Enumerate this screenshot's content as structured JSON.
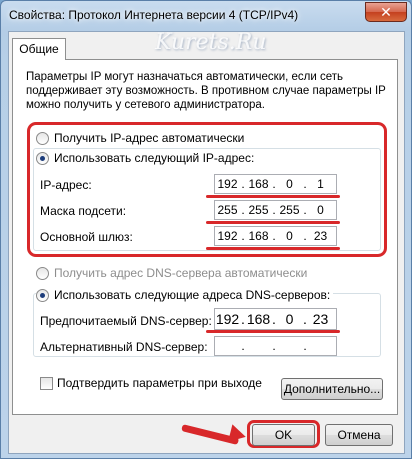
{
  "window": {
    "title": "Свойства: Протокол Интернета версии 4 (TCP/IPv4)",
    "close_glyph": "✕"
  },
  "watermark": "Kurets.Ru",
  "tabs": [
    {
      "label": "Общие"
    }
  ],
  "description": "Параметры IP могут назначаться автоматически, если сеть поддерживает эту возможность. В противном случае параметры IP можно получить у сетевого администратора.",
  "ip": {
    "auto_label": "Получить IP-адрес автоматически",
    "manual_label": "Использовать следующий IP-адрес:",
    "selected": "manual",
    "address": {
      "label": "IP-адрес:",
      "octets": [
        "192",
        "168",
        "0",
        "1"
      ]
    },
    "mask": {
      "label": "Маска подсети:",
      "octets": [
        "255",
        "255",
        "255",
        "0"
      ]
    },
    "gateway": {
      "label": "Основной шлюз:",
      "octets": [
        "192",
        "168",
        "0",
        "23"
      ]
    }
  },
  "dns": {
    "auto_label": "Получить адрес DNS-сервера автоматически",
    "manual_label": "Использовать следующие адреса DNS-серверов:",
    "selected": "manual",
    "preferred": {
      "label": "Предпочитаемый DNS-сервер:",
      "octets": [
        "192",
        "168",
        "0",
        "23"
      ]
    },
    "alternate": {
      "label": "Альтернативный DNS-сервер:",
      "octets": [
        "",
        "",
        "",
        ""
      ]
    }
  },
  "validate": {
    "label": "Подтвердить параметры при выходе",
    "checked": false
  },
  "buttons": {
    "advanced": "Дополнительно...",
    "ok": "OK",
    "cancel": "Отмена"
  },
  "colors": {
    "highlight": "#d8282a",
    "title_bg": "#b6cfe7",
    "client_bg": "#f0f0f0"
  }
}
